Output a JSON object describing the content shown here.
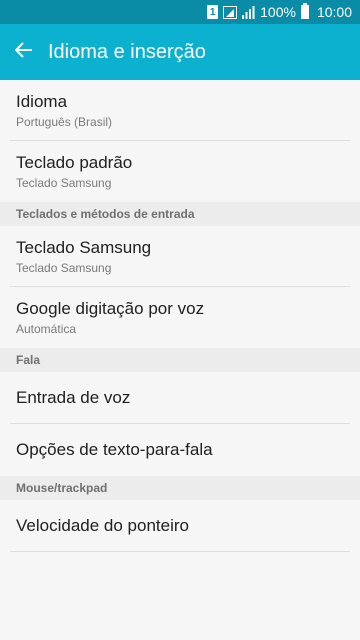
{
  "status_bar": {
    "sim": "1",
    "battery_percent": "100%",
    "time": "10:00"
  },
  "app_bar": {
    "title": "Idioma e inserção",
    "back_icon": "arrow-back-icon",
    "accent_color": "#0bb1cf"
  },
  "items": {
    "idioma": {
      "title": "Idioma",
      "subtitle": "Português (Brasil)"
    },
    "teclado_padrao": {
      "title": "Teclado padrão",
      "subtitle": "Teclado Samsung"
    },
    "teclado_samsung": {
      "title": "Teclado Samsung",
      "subtitle": "Teclado Samsung"
    },
    "google_voz": {
      "title": "Google digitação por voz",
      "subtitle": "Automática"
    },
    "entrada_voz": {
      "title": "Entrada de voz"
    },
    "tts": {
      "title": "Opções de texto-para-fala"
    },
    "velocidade": {
      "title": "Velocidade do ponteiro"
    }
  },
  "sections": {
    "teclados": "Teclados e métodos de entrada",
    "fala": "Fala",
    "mouse": "Mouse/trackpad"
  }
}
